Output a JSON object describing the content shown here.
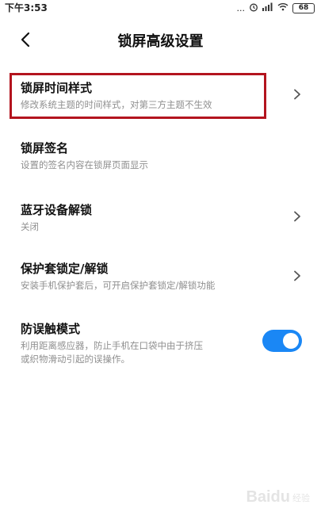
{
  "status_bar": {
    "time": "下午3:53",
    "dots": "...",
    "battery": "68"
  },
  "header": {
    "back_icon": "chevron-left-icon",
    "title": "锁屏高级设置"
  },
  "settings": [
    {
      "title": "锁屏时间样式",
      "desc": "修改系统主题的时间样式，对第三方主题不生效",
      "control": "chevron"
    },
    {
      "title": "锁屏签名",
      "desc": "设置的签名内容在锁屏页面显示",
      "control": "none"
    },
    {
      "title": "蓝牙设备解锁",
      "desc": "关闭",
      "control": "chevron"
    },
    {
      "title": "保护套锁定/解锁",
      "desc": "安装手机保护套后，可开启保护套锁定/解锁功能",
      "control": "chevron"
    },
    {
      "title": "防误触模式",
      "desc_line1": "利用距离感应器，防止手机在口袋中由于挤压",
      "desc_line2": "或织物滑动引起的误操作。",
      "control": "toggle",
      "enabled": true
    }
  ],
  "colors": {
    "accent": "#1a87f5",
    "highlight": "#b3141e",
    "desc_text": "#8f8f8f"
  },
  "watermark": {
    "main": "Baidu",
    "sub": "经验"
  }
}
